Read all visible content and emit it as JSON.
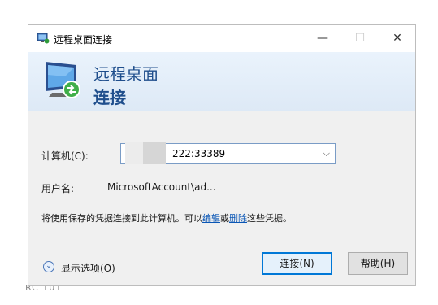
{
  "window": {
    "title": "远程桌面连接",
    "controls": {
      "minimize": "—",
      "maximize": "☐",
      "close": "✕"
    }
  },
  "banner": {
    "line1": "远程桌面",
    "line2": "连接",
    "icon": "remote-desktop-icon"
  },
  "form": {
    "computer_label": "计算机(C):",
    "computer_value": "222:33389",
    "username_label": "用户名:",
    "username_value": "MicrosoftAccount\\ad..."
  },
  "notice": {
    "prefix": "将使用保存的凭据连接到此计算机。可以",
    "edit_link": "编辑",
    "or": "或",
    "delete_link": "删除",
    "suffix": "这些凭据。"
  },
  "options": {
    "label": "显示选项(O)",
    "icon": "chevron-down-icon"
  },
  "buttons": {
    "connect": "连接(N)",
    "help": "帮助(H)"
  },
  "background_text": "RC 101",
  "colors": {
    "accent": "#0078d7",
    "banner_text": "#1f4e8c",
    "link": "#0a56b5"
  }
}
